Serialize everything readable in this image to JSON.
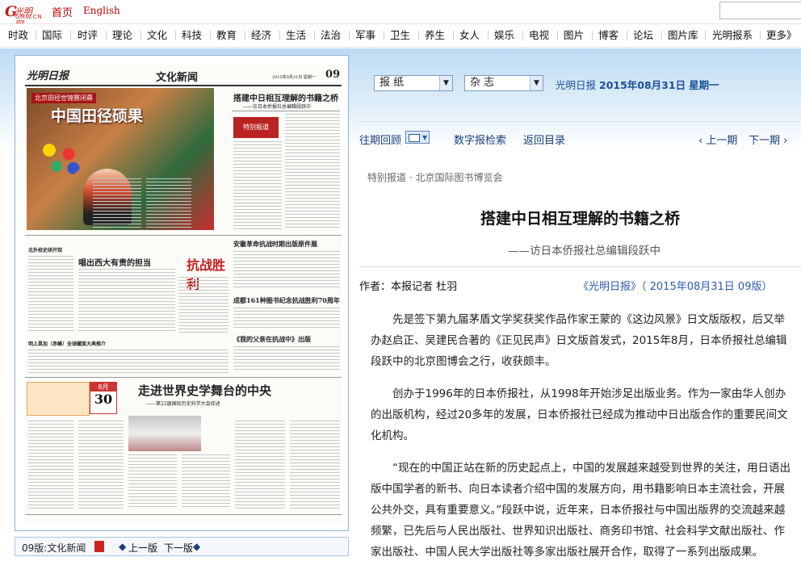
{
  "topbar": {
    "logo_text": "光明网",
    "logo_sub": "GMW.CN",
    "links": [
      "首页",
      "English"
    ]
  },
  "nav": [
    "时政",
    "国际",
    "时评",
    "理论",
    "文化",
    "科技",
    "教育",
    "经济",
    "生活",
    "法治",
    "军事",
    "卫生",
    "养生",
    "女人",
    "娱乐",
    "电视",
    "图片",
    "博客",
    "论坛",
    "图片库",
    "光明报系",
    "更多》"
  ],
  "newspaper": {
    "masthead_logo": "光明日报",
    "section_title": "文化新闻",
    "date_line": "2015年8月31日 星期一",
    "page_no": "09",
    "headlines": {
      "photo_tag": "北京田径世锦赛闭幕",
      "photo_title": "中国田径硕果",
      "bridge": "搭建中日相互理解的书籍之桥",
      "bridge_sub": "——访日本侨报社总编辑段跃中",
      "special": "特别报道",
      "ww2_book": "安徽革命抗战时期出版原件展",
      "song": "唱出西大有责的担当",
      "calligraphy": "成都161种图书纪念抗战胜利70周年",
      "memoir": "《我的父亲在抗战中》出版",
      "world_history": "走进世界史学舞台的中央",
      "world_history_sub": "——第22届国际历史科学大会综述",
      "left_small": "北外校史研开馆",
      "left_small2": "明上昌加（赤峰）全球藏族大典推介",
      "ad_text": "抗战胜利",
      "cal_month": "8月",
      "cal_day": "30"
    }
  },
  "caption_bar": {
    "label": "09版:文化新闻",
    "prev": "上一版",
    "next": "下一版"
  },
  "selectors": {
    "paper": "报 纸",
    "magazine": "杂 志"
  },
  "header_date": {
    "paper": "光明日报",
    "date": "2015年08月31日",
    "weekday": "星期一"
  },
  "subnav": {
    "archive": "往期回顾",
    "search": "数字报检索",
    "toc": "返回目录",
    "prev": "上一期",
    "next": "下一期"
  },
  "article": {
    "crumb": "特别报道 · 北京国际图书博览会",
    "title": "搭建中日相互理解的书籍之桥",
    "subtitle": "——访日本侨报社总编辑段跃中",
    "author": "作者：本报记者 杜羽",
    "source": "《光明日报》（ 2015年08月31日 09版）",
    "paragraphs": [
      "先是签下第九届茅盾文学奖获奖作品作家王蒙的《这边风景》日文版版权，后又举办赵启正、吴建民合著的《正见民声》日文版首发式，2015年8月，日本侨报社总编辑段跃中的北京图博会之行，收获颇丰。",
      "创办于1996年的日本侨报社，从1998年开始涉足出版业务。作为一家由华人创办的出版机构，经过20多年的发展，日本侨报社已经成为推动中日出版合作的重要民间文化机构。",
      "“现在的中国正站在新的历史起点上，中国的发展越来越受到世界的关注，用日语出版中国学者的新书、向日本读者介绍中国的发展方向，用书籍影响日本主流社会，开展公共外交，具有重要意义。”段跃中说，近年来，日本侨报社与中国出版界的交流越来越频繁，已先后与人民出版社、世界知识出版社、商务印书馆、社会科学文献出版社、作家出版社、中国人民大学出版社等多家出版社展开合作，取得了一系列出版成果。"
    ]
  },
  "colors": {
    "link": "#1b3e7a",
    "accent": "#c81a1a",
    "date": "#1b4f9a"
  }
}
